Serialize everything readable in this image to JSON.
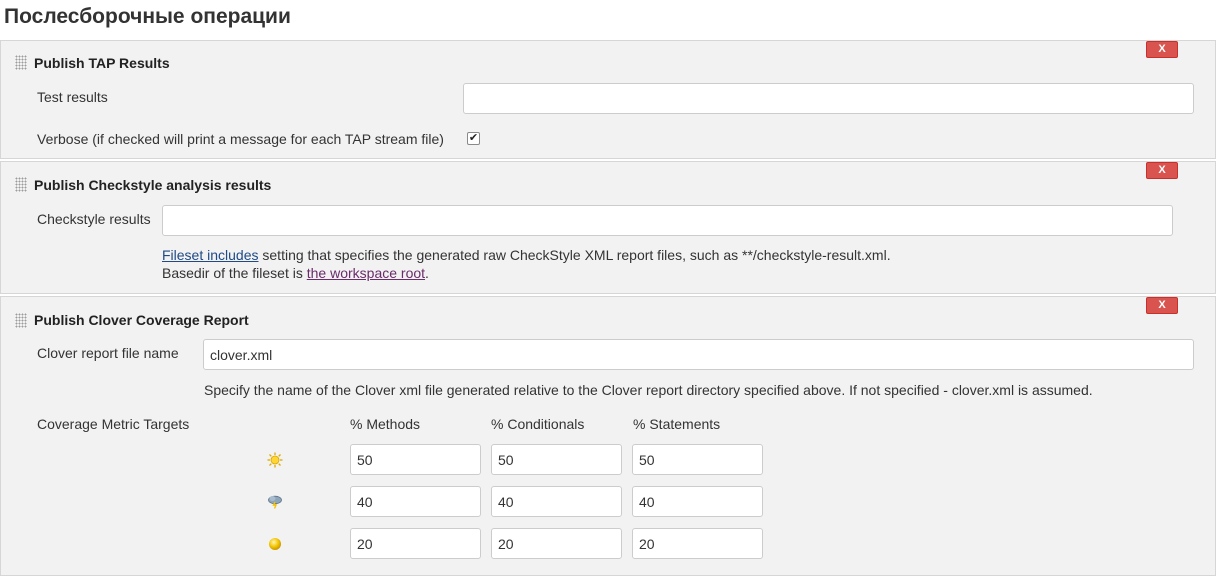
{
  "page": {
    "title": "Послесборочные операции"
  },
  "delete_label": "X",
  "tap": {
    "title": "Publish TAP Results",
    "test_results_label": "Test results",
    "test_results_value": "",
    "verbose_label": "Verbose (if checked will print a message for each TAP stream file)",
    "verbose_checked": true,
    "check_glyph": "✔"
  },
  "checkstyle": {
    "title": "Publish Checkstyle analysis results",
    "results_label": "Checkstyle results",
    "results_value": "",
    "help_link1": "Fileset includes",
    "help_text1": " setting that specifies the generated raw CheckStyle XML report files, such as **/checkstyle-result.xml.",
    "help_text2": "Basedir of the fileset is ",
    "help_link2": "the workspace root",
    "help_text3": "."
  },
  "clover": {
    "title": "Publish Clover Coverage Report",
    "file_label": "Clover report file name",
    "file_value": "clover.xml",
    "file_help": "Specify the name of the Clover xml file generated relative to the Clover report directory specified above. If not specified - clover.xml is assumed.",
    "targets_label": "Coverage Metric Targets",
    "columns": [
      "% Methods",
      "% Conditionals",
      "% Statements"
    ],
    "rows": [
      {
        "icon": "sunny-icon",
        "values": [
          "50",
          "50",
          "50"
        ]
      },
      {
        "icon": "stormy-icon",
        "values": [
          "40",
          "40",
          "40"
        ]
      },
      {
        "icon": "yellow-ball-icon",
        "values": [
          "20",
          "20",
          "20"
        ]
      }
    ]
  },
  "colors": {
    "accent_red": "#d9534f",
    "link": "#204a87",
    "visited_link": "#6a2c6a",
    "panel_bg": "#f2f2f2"
  }
}
